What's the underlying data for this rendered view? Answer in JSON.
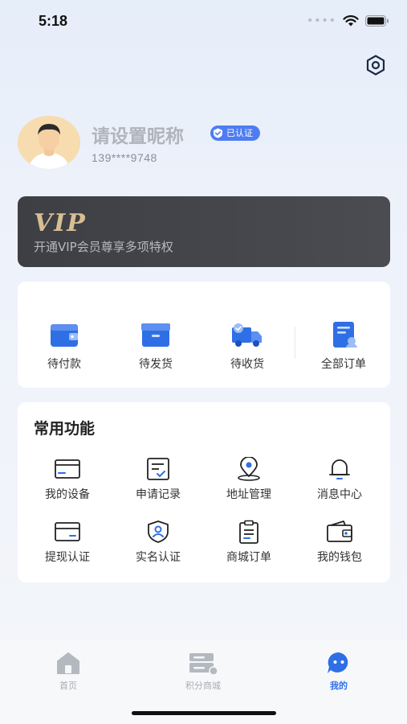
{
  "status_bar": {
    "time": "5:18"
  },
  "profile": {
    "nickname": "请设置昵称",
    "verified_badge": "已认证",
    "phone": "139****9748"
  },
  "vip": {
    "logo_text": "VIP",
    "description": "开通VIP会员尊享多项特权"
  },
  "orders": {
    "items": [
      {
        "label": "待付款",
        "icon": "wallet-icon"
      },
      {
        "label": "待发货",
        "icon": "box-icon"
      },
      {
        "label": "待收货",
        "icon": "truck-icon"
      },
      {
        "label": "全部订单",
        "icon": "orders-list-icon"
      }
    ]
  },
  "functions": {
    "title": "常用功能",
    "items": [
      {
        "label": "我的设备",
        "icon": "device-icon"
      },
      {
        "label": "申请记录",
        "icon": "record-icon"
      },
      {
        "label": "地址管理",
        "icon": "location-icon"
      },
      {
        "label": "消息中心",
        "icon": "bell-icon"
      },
      {
        "label": "提现认证",
        "icon": "card-icon"
      },
      {
        "label": "实名认证",
        "icon": "shield-user-icon"
      },
      {
        "label": "商城订单",
        "icon": "clipboard-icon"
      },
      {
        "label": "我的钱包",
        "icon": "wallet-outline-icon"
      }
    ]
  },
  "tabbar": {
    "tabs": [
      {
        "label": "首页",
        "icon": "home-icon",
        "active": false
      },
      {
        "label": "积分商城",
        "icon": "store-icon",
        "active": false
      },
      {
        "label": "我的",
        "icon": "profile-bubble-icon",
        "active": true
      }
    ]
  },
  "colors": {
    "accent": "#2f6fe6",
    "vip_gold": "#d8be92",
    "vip_bg": "#3d3f44"
  }
}
